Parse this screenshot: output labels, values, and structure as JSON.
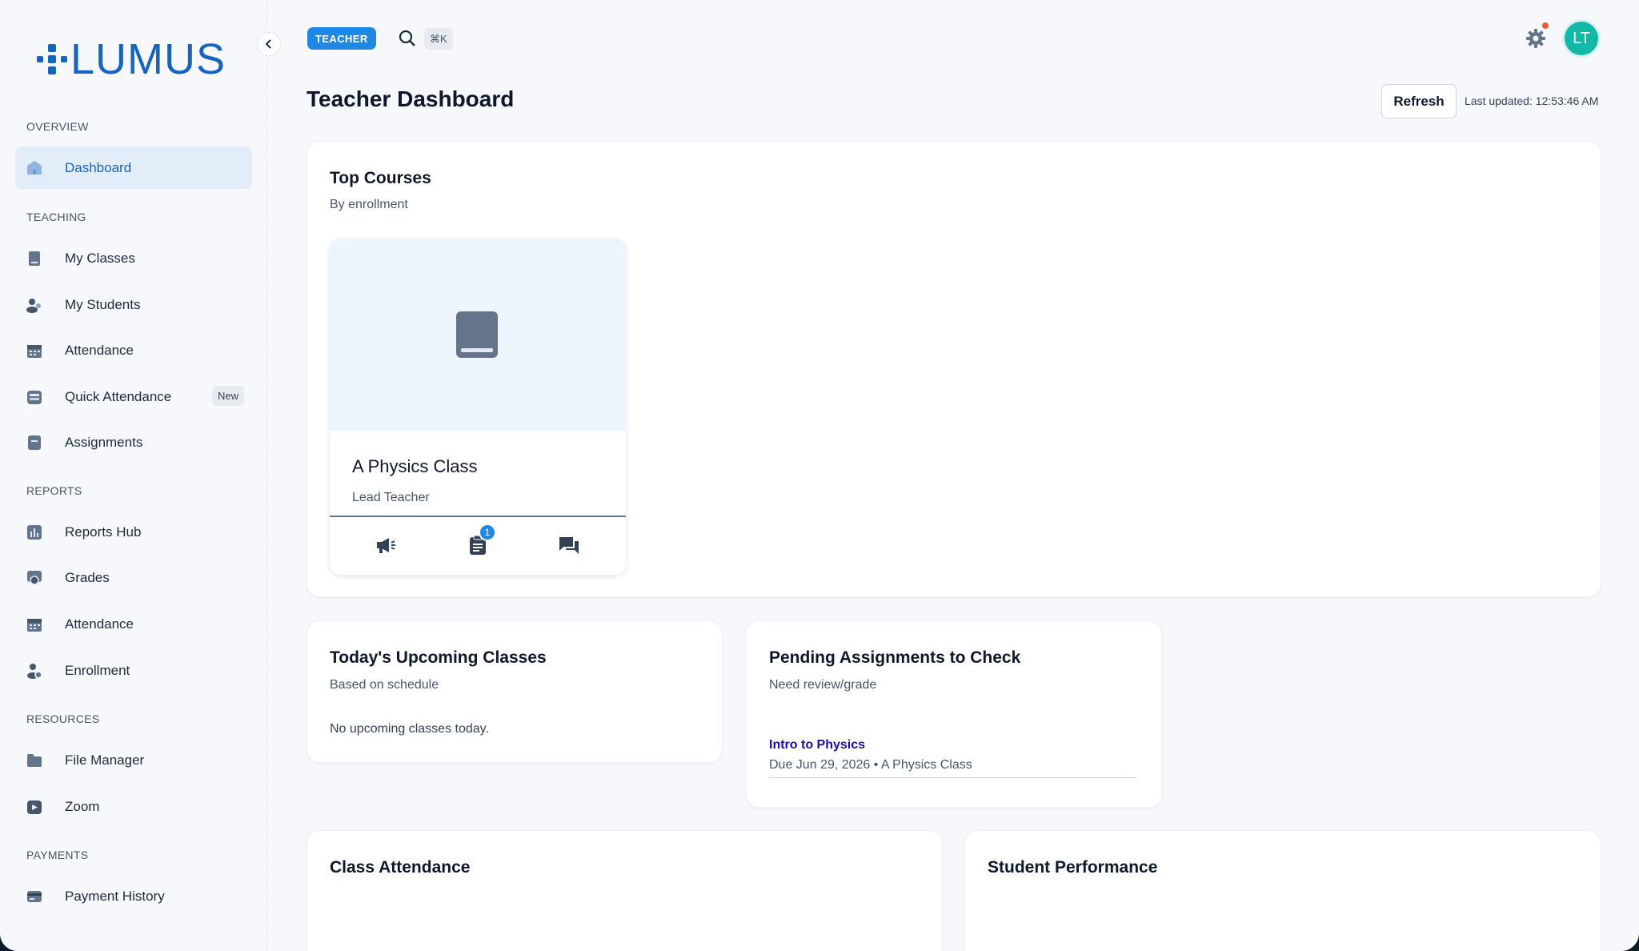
{
  "brand": {
    "name": "LUMUS"
  },
  "sidebar": {
    "sections": [
      {
        "label": "OVERVIEW"
      },
      {
        "label": "TEACHING"
      },
      {
        "label": "REPORTS"
      },
      {
        "label": "RESOURCES"
      },
      {
        "label": "PAYMENTS"
      }
    ],
    "items": [
      {
        "label": "Dashboard",
        "icon": "dashboard-icon",
        "active": true
      },
      {
        "label": "My Classes",
        "icon": "book-icon"
      },
      {
        "label": "My Students",
        "icon": "students-icon"
      },
      {
        "label": "Attendance",
        "icon": "calendar-icon"
      },
      {
        "label": "Quick Attendance",
        "icon": "quick-attendance-icon",
        "badge": "New"
      },
      {
        "label": "Assignments",
        "icon": "assignment-icon"
      },
      {
        "label": "Reports Hub",
        "icon": "bar-chart-icon"
      },
      {
        "label": "Grades",
        "icon": "grades-icon"
      },
      {
        "label": "Attendance",
        "icon": "calendar-icon"
      },
      {
        "label": "Enrollment",
        "icon": "enrollment-icon"
      },
      {
        "label": "File Manager",
        "icon": "folder-icon"
      },
      {
        "label": "Zoom",
        "icon": "video-icon"
      },
      {
        "label": "Payment History",
        "icon": "card-icon"
      }
    ]
  },
  "header": {
    "role": "TEACHER",
    "search_shortcut": "⌘K",
    "avatar_initials": "LT",
    "title": "Teacher Dashboard",
    "refresh_label": "Refresh",
    "last_updated": "Last updated: 12:53:46 AM"
  },
  "top_courses": {
    "title": "Top Courses",
    "subtitle": "By enrollment",
    "courses": [
      {
        "name": "A Physics Class",
        "role": "Lead Teacher",
        "assignment_count": "1"
      }
    ]
  },
  "upcoming": {
    "title": "Today's Upcoming Classes",
    "subtitle": "Based on schedule",
    "empty": "No upcoming classes today."
  },
  "pending": {
    "title": "Pending Assignments to Check",
    "subtitle": "Need review/grade",
    "items": [
      {
        "title": "Intro to Physics",
        "meta": "Due Jun 29, 2026 • A Physics Class"
      }
    ]
  },
  "class_attendance": {
    "title": "Class Attendance"
  },
  "student_performance": {
    "title": "Student Performance"
  },
  "colors": {
    "accent": "#1565c0",
    "role_pill": "#1e88e5",
    "avatar": "#14b8a6",
    "notification": "#ef5b3a"
  }
}
